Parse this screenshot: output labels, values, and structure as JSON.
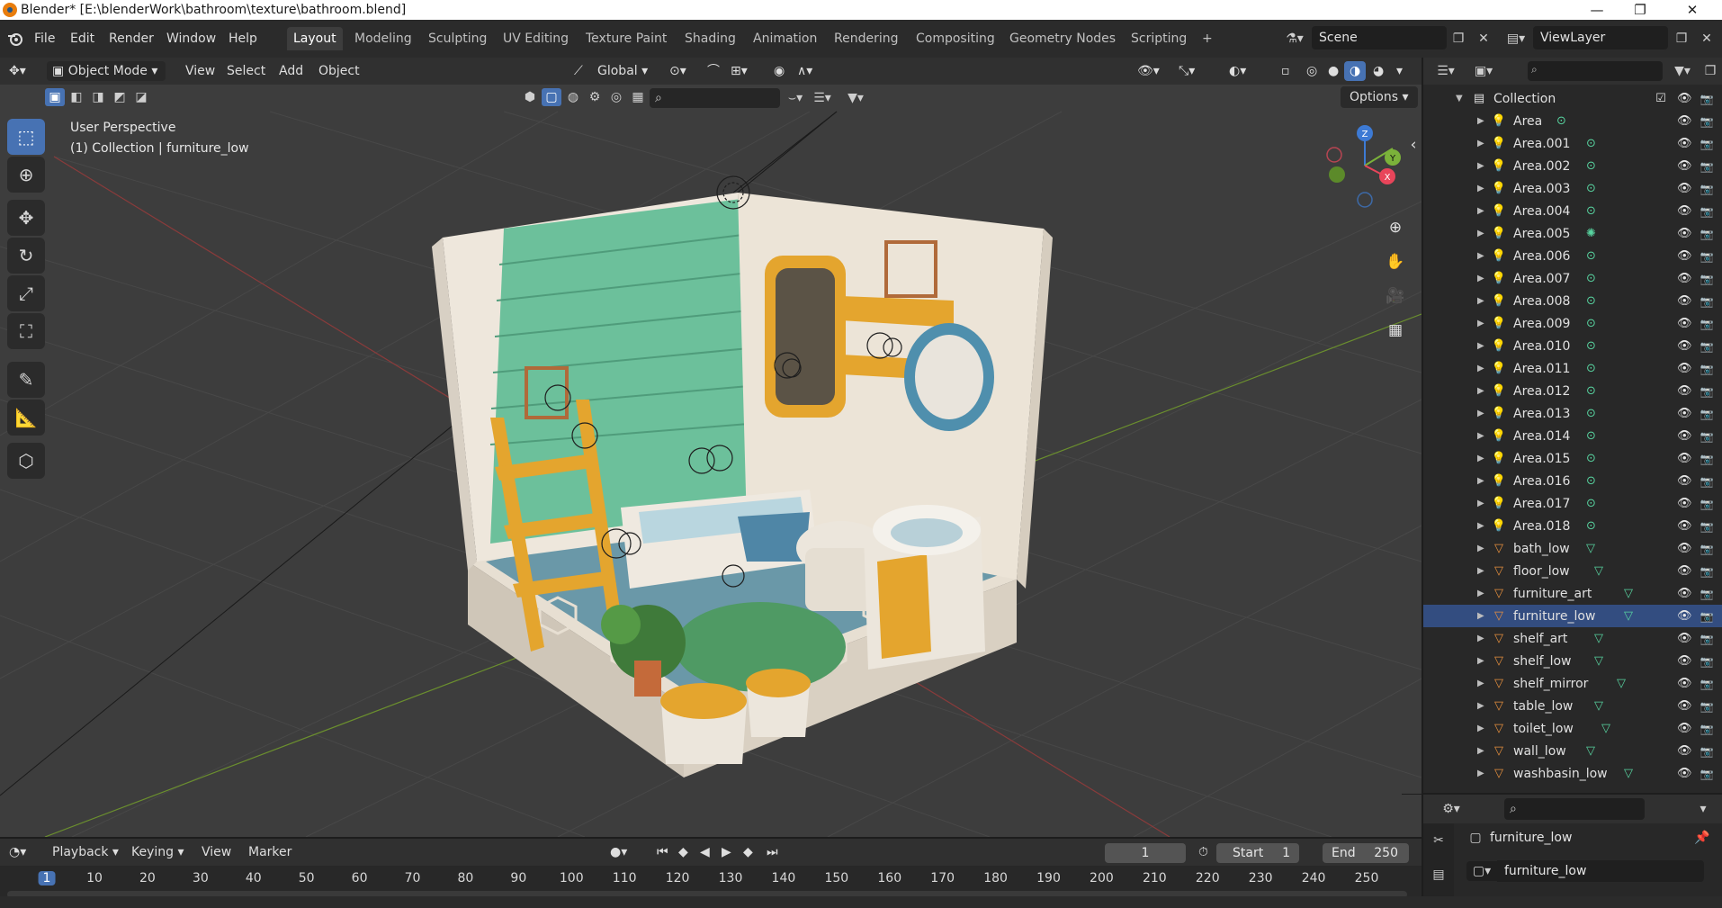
{
  "window": {
    "title": "Blender* [E:\\blenderWork\\bathroom\\texture\\bathroom.blend]",
    "minimize": "—",
    "maximize": "❐",
    "close": "✕"
  },
  "menu": {
    "file": "File",
    "edit": "Edit",
    "render": "Render",
    "window": "Window",
    "help": "Help"
  },
  "workspaces": [
    "Layout",
    "Modeling",
    "Sculpting",
    "UV Editing",
    "Texture Paint",
    "Shading",
    "Animation",
    "Rendering",
    "Compositing",
    "Geometry Nodes",
    "Scripting"
  ],
  "active_workspace": "Layout",
  "add_workspace": "+",
  "scene": "Scene",
  "view_layer": "ViewLayer",
  "viewport": {
    "mode": "Object Mode",
    "menus": [
      "View",
      "Select",
      "Add",
      "Object"
    ],
    "transform_orientation": "Global",
    "perspective_label": "User Perspective",
    "collection_label": "(1) Collection | furniture_low",
    "options": "Options",
    "gizmo": {
      "x": "X",
      "y": "Y",
      "z": "Z"
    }
  },
  "outliner": {
    "root": "Collection",
    "items": [
      {
        "name": "Area",
        "type": "light"
      },
      {
        "name": "Area.001",
        "type": "light"
      },
      {
        "name": "Area.002",
        "type": "light"
      },
      {
        "name": "Area.003",
        "type": "light"
      },
      {
        "name": "Area.004",
        "type": "light"
      },
      {
        "name": "Area.005",
        "type": "light-sun"
      },
      {
        "name": "Area.006",
        "type": "light"
      },
      {
        "name": "Area.007",
        "type": "light"
      },
      {
        "name": "Area.008",
        "type": "light"
      },
      {
        "name": "Area.009",
        "type": "light"
      },
      {
        "name": "Area.010",
        "type": "light"
      },
      {
        "name": "Area.011",
        "type": "light"
      },
      {
        "name": "Area.012",
        "type": "light"
      },
      {
        "name": "Area.013",
        "type": "light"
      },
      {
        "name": "Area.014",
        "type": "light"
      },
      {
        "name": "Area.015",
        "type": "light"
      },
      {
        "name": "Area.016",
        "type": "light"
      },
      {
        "name": "Area.017",
        "type": "light"
      },
      {
        "name": "Area.018",
        "type": "light"
      },
      {
        "name": "bath_low",
        "type": "mesh"
      },
      {
        "name": "floor_low",
        "type": "mesh"
      },
      {
        "name": "furniture_art",
        "type": "mesh"
      },
      {
        "name": "furniture_low",
        "type": "mesh",
        "selected": true
      },
      {
        "name": "shelf_art",
        "type": "mesh"
      },
      {
        "name": "shelf_low",
        "type": "mesh"
      },
      {
        "name": "shelf_mirror",
        "type": "mesh"
      },
      {
        "name": "table_low",
        "type": "mesh"
      },
      {
        "name": "toilet_low",
        "type": "mesh"
      },
      {
        "name": "wall_low",
        "type": "mesh"
      },
      {
        "name": "washbasin_low",
        "type": "mesh"
      }
    ]
  },
  "properties": {
    "object_name": "furniture_low",
    "data_name": "furniture_low"
  },
  "timeline": {
    "menus": [
      "Playback",
      "Keying",
      "View",
      "Marker"
    ],
    "current_frame": "1",
    "start_label": "Start",
    "start_value": "1",
    "end_label": "End",
    "end_value": "250",
    "ticks": [
      "1",
      "10",
      "20",
      "30",
      "40",
      "50",
      "60",
      "70",
      "80",
      "90",
      "100",
      "110",
      "120",
      "130",
      "140",
      "150",
      "160",
      "170",
      "180",
      "190",
      "200",
      "210",
      "220",
      "230",
      "240",
      "250"
    ]
  },
  "colors": {
    "accent": "#4772b3",
    "light_icon": "#e8903e",
    "mesh_icon": "#e8903e",
    "data_icon": "#58d4a0"
  }
}
